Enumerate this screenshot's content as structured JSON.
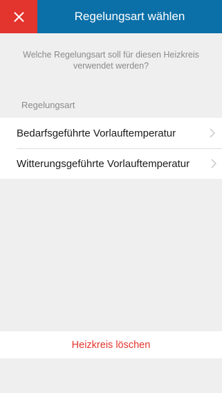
{
  "header": {
    "close_icon": "close-icon",
    "title": "Regelungsart wählen"
  },
  "question": "Welche Regelungsart soll für diesen Heizkreis verwendet werden?",
  "section": {
    "title": "Regelungsart"
  },
  "options": [
    {
      "label": "Bedarfsgeführte Vorlauftemperatur",
      "icon": "chevron-right-icon"
    },
    {
      "label": "Witterungsgeführte Vorlauftemperatur",
      "icon": "chevron-right-icon"
    }
  ],
  "actions": {
    "delete_label": "Heizkreis löschen"
  },
  "colors": {
    "header_bg": "#0b6fa8",
    "close_bg": "#e3342d",
    "destructive": "#e3342d",
    "background": "#efefef"
  }
}
